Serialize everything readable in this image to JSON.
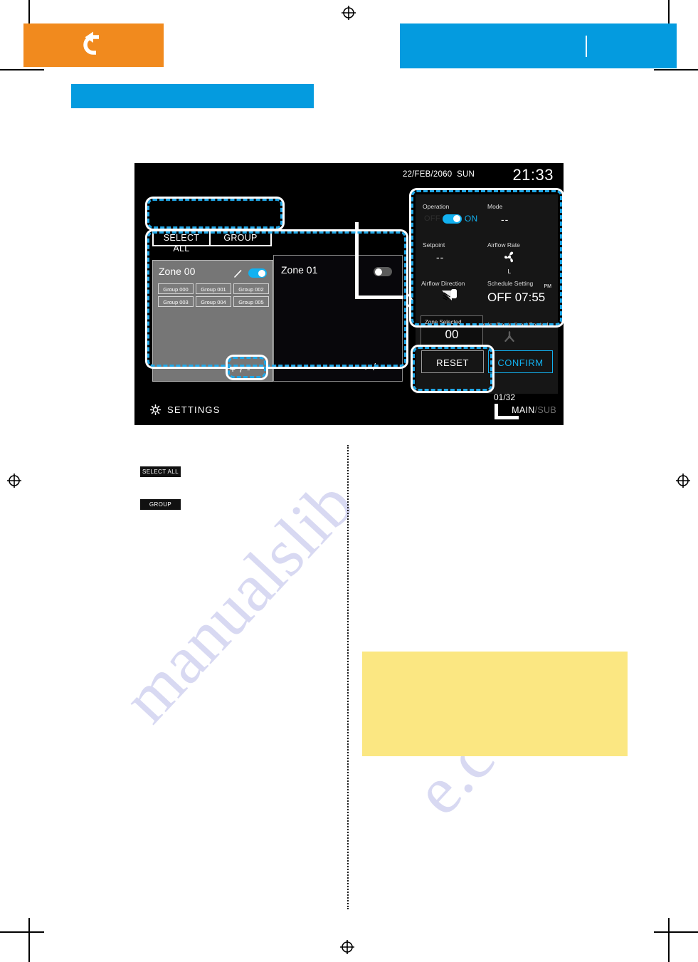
{
  "page": {
    "header": {
      "back_icon": "back-arrow-icon",
      "accent_orange": "#f18a1e",
      "accent_blue": "#049bdf"
    },
    "note_block": {
      "background": "#fbe782",
      "text": ""
    },
    "inline_keys": [
      {
        "name": "select-all",
        "label": "SELECT ALL"
      },
      {
        "name": "group",
        "label": "GROUP"
      }
    ],
    "watermark": {
      "line1": "manualslib",
      "line2": "e.com"
    }
  },
  "device": {
    "status_bar": {
      "date": "22/FEB/2060",
      "weekday": "SUN",
      "time": "21:33"
    },
    "buttons": {
      "select_all": "SELECT ALL",
      "group": "GROUP"
    },
    "zones": [
      {
        "title": "Zone 00",
        "selected": true,
        "toggle": "on",
        "edit_icon": "pencil-icon",
        "groups": [
          "Group 000",
          "Group 001",
          "Group 002",
          "Group 003",
          "Group 004",
          "Group 005"
        ],
        "plus_minus": "+ / -"
      },
      {
        "title": "Zone 01",
        "selected": false,
        "toggle": "off",
        "groups": [],
        "plus_minus": "+ / -"
      }
    ],
    "page_indicator": "01/32",
    "footer": {
      "settings_label": "SETTINGS",
      "settings_icon": "gear-icon",
      "main_label": "MAIN",
      "separator": "/",
      "sub_label": "SUB"
    },
    "info_panel": {
      "operation": {
        "label": "Operation",
        "off_text": "OFF",
        "on_text": "ON",
        "state": "on"
      },
      "mode": {
        "label": "Mode",
        "value": "--"
      },
      "setpoint": {
        "label": "Setpoint",
        "value": "--"
      },
      "airflow_rate": {
        "label": "Airflow Rate",
        "value": "L",
        "icon": "fan-icon"
      },
      "airflow_direction": {
        "label": "Airflow Direction",
        "icon": "louver-icon"
      },
      "schedule_setting": {
        "label": "Schedule Setting",
        "meridiem": "PM",
        "value": "OFF  07:55"
      },
      "centralized": {
        "label": "Under Centralized Control",
        "icon": "centralized-control-icon"
      },
      "zone_selected": {
        "label": "Zone Selected",
        "value": "00"
      },
      "actions": {
        "reset": "RESET",
        "confirm": "CONFIRM"
      }
    },
    "colors": {
      "accent_cyan": "#12b1f0",
      "highlight_dashed": "#20a8e8",
      "screen_background": "#000000"
    }
  }
}
